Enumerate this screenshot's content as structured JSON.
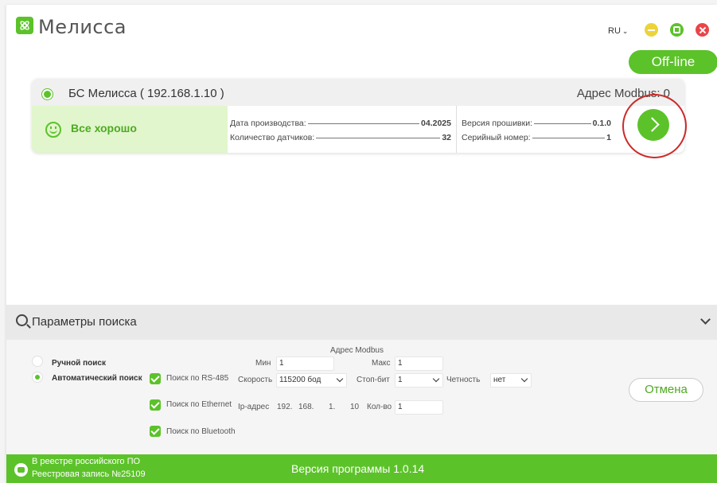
{
  "app": {
    "title": "Мелисса"
  },
  "titlebar": {
    "language": "RU"
  },
  "connection_status": "Off-line",
  "device": {
    "name": "БС Мелисса ( 192.168.1.10 )",
    "modbus_address_label": "Адрес Modbus: 0",
    "status_text": "Все хорошо",
    "production_date_label": "Дата производства:",
    "production_date_value": "04.2025",
    "sensors_count_label": "Количество датчиков:",
    "sensors_count_value": "32",
    "firmware_label": "Версия прошивки:",
    "firmware_value": "0.1.0",
    "serial_label": "Серийный номер:",
    "serial_value": "1"
  },
  "search": {
    "title": "Параметры поиска",
    "manual_label": "Ручной поиск",
    "auto_label": "Автоматический поиск",
    "mode_selected": "auto",
    "modbus_address_caption": "Адрес Modbus",
    "min_label": "Мин",
    "min_value": "1",
    "max_label": "Макс",
    "max_value": "1",
    "rs485_label": "Поиск по RS-485",
    "speed_label": "Скорость",
    "speed_value": "115200 бод",
    "stopbit_label": "Стоп-бит",
    "stopbit_value": "1",
    "parity_label": "Четность",
    "parity_value": "нет",
    "ethernet_label": "Поиск по Ethernet",
    "ip_label": "Ip-адрес",
    "ip_octets": [
      "192.",
      "168.",
      "1.",
      "10"
    ],
    "count_label": "Кол-во",
    "count_value": "1",
    "bluetooth_label": "Поиск по Bluetooth",
    "cancel_label": "Отмена"
  },
  "footer": {
    "registry_line1": "В реестре российского ПО",
    "registry_line2": "Реестровая запись №25109",
    "version": "Версия программы  1.0.14"
  },
  "colors": {
    "accent": "#5cc22a",
    "status_bg": "#e1f6cc",
    "close": "#e9454a",
    "minimize": "#ecd33a",
    "highlight_ring": "#cc2a2a"
  }
}
